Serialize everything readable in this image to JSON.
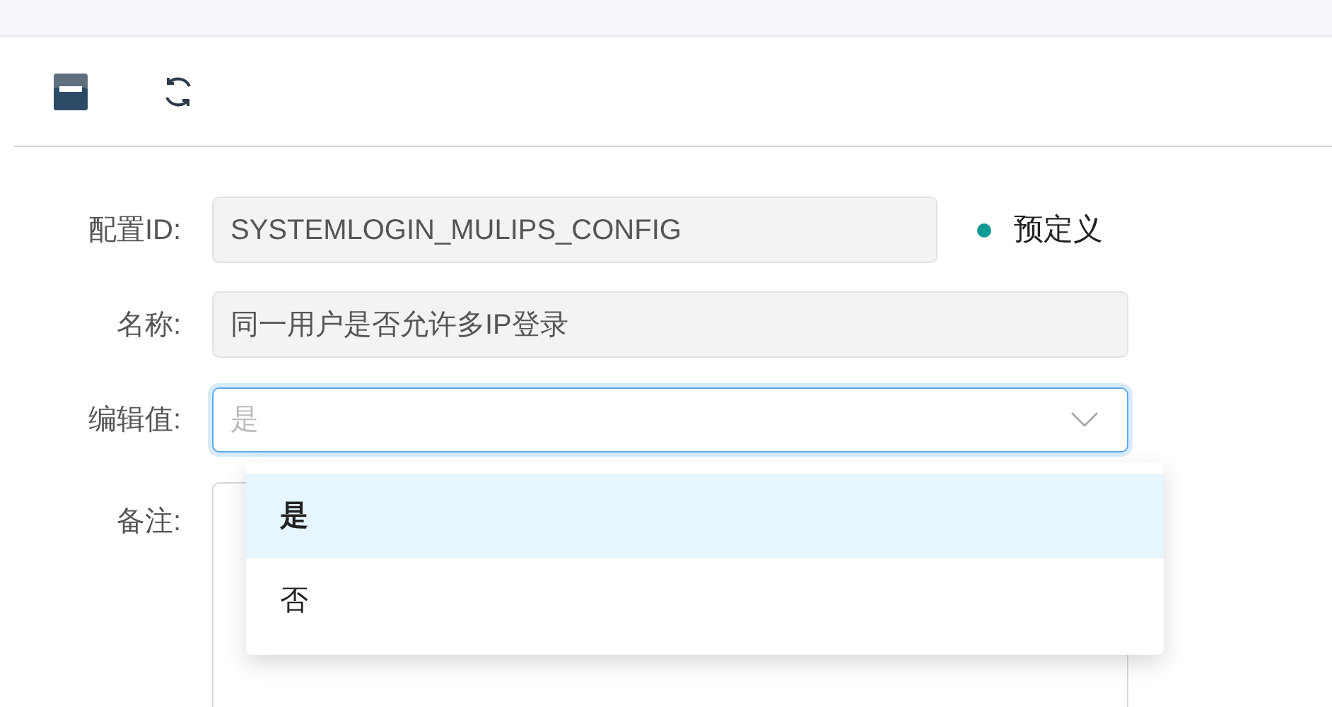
{
  "toolbar": {
    "buttons": [
      {
        "kind": "save"
      },
      {
        "kind": "refresh"
      }
    ]
  },
  "form": {
    "config_id": {
      "label": "配置ID:",
      "value": "SYSTEMLOGIN_MULIPS_CONFIG"
    },
    "status": {
      "label": "预定义",
      "color": "#0f9a94"
    },
    "name": {
      "label": "名称:",
      "value": "同一用户是否允许多IP登录"
    },
    "edit_value": {
      "label": "编辑值:",
      "placeholder": "是",
      "expanded": true,
      "options": [
        {
          "label": "是",
          "selected": true
        },
        {
          "label": "否",
          "selected": false
        }
      ]
    },
    "remark": {
      "label": "备注:"
    }
  }
}
